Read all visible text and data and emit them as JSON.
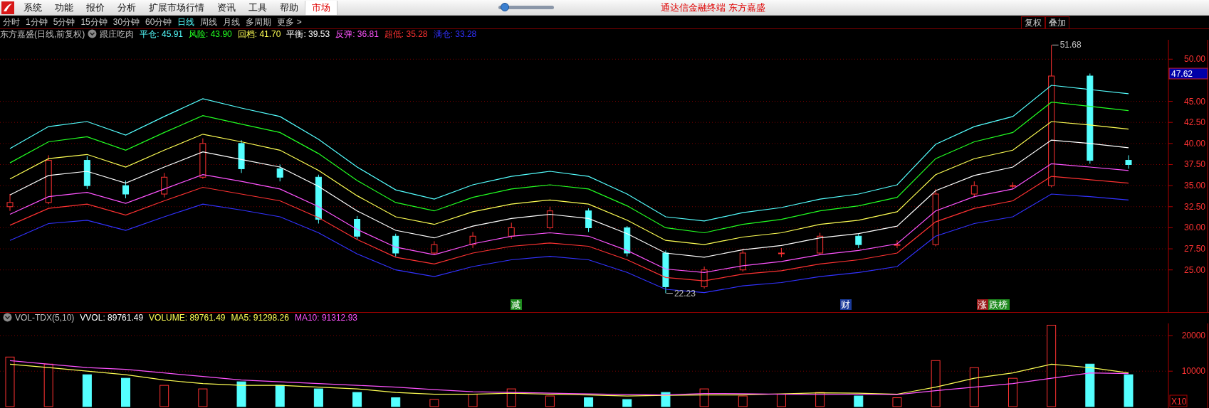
{
  "menu_bar": {
    "items": [
      {
        "label": "系统",
        "selected": false
      },
      {
        "label": "功能",
        "selected": false
      },
      {
        "label": "报价",
        "selected": false
      },
      {
        "label": "分析",
        "selected": false
      },
      {
        "label": "扩展市场行情",
        "selected": false
      },
      {
        "label": "资讯",
        "selected": false
      },
      {
        "label": "工具",
        "selected": false
      },
      {
        "label": "帮助",
        "selected": false
      },
      {
        "label": "市场",
        "selected": true
      }
    ],
    "slider": {
      "level": 0.05
    },
    "title": "通达信金融终端  东方嘉盛"
  },
  "period_bar": {
    "tabs": [
      {
        "label": "分时",
        "selected": false
      },
      {
        "label": "1分钟",
        "selected": false
      },
      {
        "label": "5分钟",
        "selected": false
      },
      {
        "label": "15分钟",
        "selected": false
      },
      {
        "label": "30分钟",
        "selected": false
      },
      {
        "label": "60分钟",
        "selected": false
      },
      {
        "label": "日线",
        "selected": true
      },
      {
        "label": "周线",
        "selected": false
      },
      {
        "label": "月线",
        "selected": false
      },
      {
        "label": "多周期",
        "selected": false
      },
      {
        "label": "更多 >",
        "selected": false
      }
    ],
    "buttons": [
      "复权",
      "叠加"
    ]
  },
  "main_panel": {
    "legend": {
      "title": "东方嘉盛(日线,前复权)",
      "indicator": "跟庄吃肉",
      "items": [
        {
          "label": "平仓:",
          "value": "45.91",
          "color": "#54ffff"
        },
        {
          "label": "风险:",
          "value": "43.90",
          "color": "#22ff22"
        },
        {
          "label": "回档:",
          "value": "41.70",
          "color": "#ffff54"
        },
        {
          "label": "平衡:",
          "value": "39.53",
          "color": "#ffffff"
        },
        {
          "label": "反弹:",
          "value": "36.81",
          "color": "#ff54ff"
        },
        {
          "label": "超低:",
          "value": "35.28",
          "color": "#ff3232"
        },
        {
          "label": "满仓:",
          "value": "33.28",
          "color": "#3232ff"
        }
      ]
    },
    "chart_data": {
      "type": "candlestick",
      "grid": true,
      "ylim": [
        20,
        52.3
      ],
      "yticks": [
        {
          "value": 25,
          "label": "25.00"
        },
        {
          "value": 27.5,
          "label": "27.50"
        },
        {
          "value": 30,
          "label": "30.00"
        },
        {
          "value": 32.5,
          "label": "32.50"
        },
        {
          "value": 35,
          "label": "35.00"
        },
        {
          "value": 37.5,
          "label": "37.50"
        },
        {
          "value": 40,
          "label": "40.00"
        },
        {
          "value": 42.5,
          "label": "42.50"
        },
        {
          "value": 45,
          "label": "45.00"
        },
        {
          "value": 50,
          "label": "50.00"
        }
      ],
      "ohlc": [
        [
          32.5,
          34,
          32,
          33
        ],
        [
          33,
          38.6,
          32.8,
          38
        ],
        [
          38,
          38.5,
          34.6,
          35
        ],
        [
          35,
          35.6,
          33.5,
          34
        ],
        [
          34,
          36.5,
          33.6,
          36
        ],
        [
          36,
          40.6,
          35.8,
          40
        ],
        [
          40,
          40.4,
          36.5,
          37
        ],
        [
          37,
          37.5,
          35.5,
          36
        ],
        [
          36,
          36.3,
          30.5,
          31
        ],
        [
          31,
          31.4,
          28.6,
          29
        ],
        [
          29,
          29.3,
          26.6,
          27
        ],
        [
          27,
          28.4,
          26.8,
          28
        ],
        [
          28,
          29.5,
          27.6,
          29
        ],
        [
          29,
          30.6,
          28.7,
          30
        ],
        [
          30,
          32.5,
          29.8,
          32
        ],
        [
          32,
          32.3,
          29.5,
          30
        ],
        [
          30,
          30.2,
          26.6,
          27
        ],
        [
          27,
          27.3,
          22.23,
          23
        ],
        [
          23,
          25.4,
          22.8,
          25
        ],
        [
          25,
          27.5,
          24.8,
          27
        ],
        [
          27,
          27.6,
          26.5,
          27
        ],
        [
          27,
          29.4,
          26.8,
          29
        ],
        [
          29,
          29.3,
          27.6,
          28
        ],
        [
          28,
          28.5,
          27.6,
          28
        ],
        [
          28,
          34.6,
          27.8,
          34
        ],
        [
          34,
          35.5,
          33.6,
          35
        ],
        [
          35,
          35.4,
          34.6,
          35
        ],
        [
          35,
          51.68,
          34.8,
          48
        ],
        [
          48,
          48.3,
          37.6,
          38
        ],
        [
          38,
          38.6,
          37,
          37.5
        ]
      ],
      "series": [
        {
          "type": "line",
          "color": "#54ffff",
          "values": [
            39.4,
            42.0,
            42.6,
            41.0,
            43.2,
            45.3,
            44.2,
            43.2,
            40.5,
            37.2,
            34.5,
            33.4,
            35.1,
            36.1,
            36.7,
            36.1,
            34.0,
            31.3,
            30.8,
            31.8,
            32.4,
            33.4,
            34.0,
            35.1,
            39.9,
            42.0,
            43.2,
            46.9,
            46.4,
            45.9
          ]
        },
        {
          "type": "line",
          "color": "#22ff22",
          "values": [
            37.7,
            40.2,
            40.8,
            39.2,
            41.3,
            43.3,
            42.3,
            41.3,
            38.8,
            35.6,
            33.0,
            32.0,
            33.6,
            34.6,
            35.1,
            34.6,
            32.6,
            30.0,
            29.4,
            30.4,
            31.0,
            32.0,
            32.6,
            33.6,
            38.2,
            40.2,
            41.3,
            44.9,
            44.4,
            43.9
          ]
        },
        {
          "type": "line",
          "color": "#ffff54",
          "values": [
            35.8,
            38.2,
            38.7,
            37.2,
            39.2,
            41.1,
            40.2,
            39.2,
            36.8,
            33.8,
            31.3,
            30.4,
            31.9,
            32.8,
            33.3,
            32.8,
            30.9,
            28.5,
            28.0,
            28.9,
            29.4,
            30.4,
            30.9,
            31.9,
            36.3,
            38.2,
            39.2,
            42.6,
            42.2,
            41.7
          ]
        },
        {
          "type": "line",
          "color": "#ffffff",
          "values": [
            33.9,
            36.2,
            36.7,
            35.3,
            37.2,
            39.0,
            38.1,
            37.2,
            34.9,
            32.0,
            29.7,
            28.8,
            30.2,
            31.1,
            31.6,
            31.1,
            29.3,
            27.0,
            26.5,
            27.4,
            27.9,
            28.8,
            29.3,
            30.2,
            34.4,
            36.2,
            37.2,
            40.4,
            40.0,
            39.5
          ]
        },
        {
          "type": "line",
          "color": "#ff54ff",
          "values": [
            31.6,
            33.7,
            34.2,
            32.9,
            34.6,
            36.3,
            35.5,
            34.6,
            32.5,
            29.8,
            27.7,
            26.8,
            28.1,
            29.0,
            29.4,
            29.0,
            27.3,
            25.1,
            24.7,
            25.5,
            26.0,
            26.8,
            27.3,
            28.1,
            32.0,
            33.7,
            34.6,
            37.6,
            37.2,
            36.8
          ]
        },
        {
          "type": "line",
          "color": "#ff3232",
          "values": [
            30.3,
            32.3,
            32.8,
            31.5,
            33.2,
            34.8,
            34.0,
            33.2,
            31.2,
            28.6,
            26.5,
            25.7,
            27.0,
            27.8,
            28.2,
            27.8,
            26.2,
            24.1,
            23.7,
            24.5,
            24.9,
            25.7,
            26.2,
            27.0,
            30.7,
            32.3,
            33.2,
            36.1,
            35.7,
            35.3
          ]
        },
        {
          "type": "line",
          "color": "#3232ff",
          "values": [
            28.5,
            30.5,
            30.9,
            29.7,
            31.3,
            32.8,
            32.1,
            31.3,
            29.4,
            26.9,
            25.0,
            24.2,
            25.4,
            26.2,
            26.6,
            26.2,
            24.7,
            22.7,
            22.3,
            23.1,
            23.5,
            24.2,
            24.7,
            25.4,
            29.0,
            30.5,
            31.3,
            34.0,
            33.7,
            33.3
          ]
        }
      ],
      "annotations": [
        "51.68",
        {
          "y": 22.23,
          "text": "22.23"
        }
      ]
    },
    "price_tag": "47.62",
    "events": [
      {
        "text": "减",
        "color": "#1e8a1e"
      },
      {
        "text": "财",
        "color": "#1a3a9a"
      },
      {
        "text": "涨",
        "color": "#9a1a1a"
      },
      {
        "text": "跌榜",
        "color": "#1e8a1e"
      }
    ]
  },
  "volume_panel": {
    "legend": {
      "indicator": "VOL-TDX(5,10)",
      "items": [
        {
          "label": "VVOL:",
          "value": "89761.49",
          "color": "#ffffff"
        },
        {
          "label": "VOLUME:",
          "value": "89761.49",
          "color": "#ffff54"
        },
        {
          "label": "MA5:",
          "value": "91298.26",
          "color": "#ffff54"
        },
        {
          "label": "MA10:",
          "value": "91312.93",
          "color": "#ff54ff"
        }
      ]
    },
    "chart_data": {
      "type": "bar",
      "grid": true,
      "ylim": [
        0,
        23500
      ],
      "yticks": [
        10000,
        20000
      ],
      "series": [
        {
          "type": "bar",
          "color": "#ff3232",
          "values": [
            14000,
            12000,
            null,
            null,
            6000,
            5000,
            null,
            null,
            null,
            null,
            null,
            2000,
            3500,
            5000,
            3000,
            null,
            null,
            null,
            5000,
            3000,
            3500,
            4000,
            null,
            2500,
            13000,
            11000,
            8000,
            23000,
            null,
            null
          ]
        },
        {
          "type": "bar",
          "color": "#54ffff",
          "values": [
            null,
            null,
            9000,
            8000,
            null,
            null,
            7000,
            6000,
            5000,
            4000,
            2500,
            null,
            null,
            null,
            null,
            2500,
            2000,
            4000,
            null,
            null,
            null,
            null,
            3000,
            null,
            null,
            null,
            null,
            null,
            12000,
            9000
          ]
        },
        {
          "type": "line",
          "color": "#ffff54",
          "values": [
            12000,
            11000,
            10000,
            9000,
            7500,
            6500,
            6000,
            6000,
            5500,
            5000,
            4000,
            3500,
            3500,
            3800,
            3500,
            3300,
            3000,
            3200,
            3300,
            3300,
            3600,
            3900,
            3800,
            3500,
            5500,
            8000,
            9500,
            12000,
            11000,
            9500
          ]
        },
        {
          "type": "line",
          "color": "#ff54ff",
          "values": [
            13000,
            12000,
            11000,
            10500,
            9500,
            8500,
            7500,
            7000,
            6500,
            6000,
            5500,
            4800,
            4200,
            4000,
            3800,
            3600,
            3400,
            3300,
            3700,
            3650,
            3500,
            3400,
            3500,
            3400,
            4500,
            5500,
            6500,
            8000,
            9500,
            9300
          ]
        }
      ]
    },
    "unit": "X10"
  }
}
